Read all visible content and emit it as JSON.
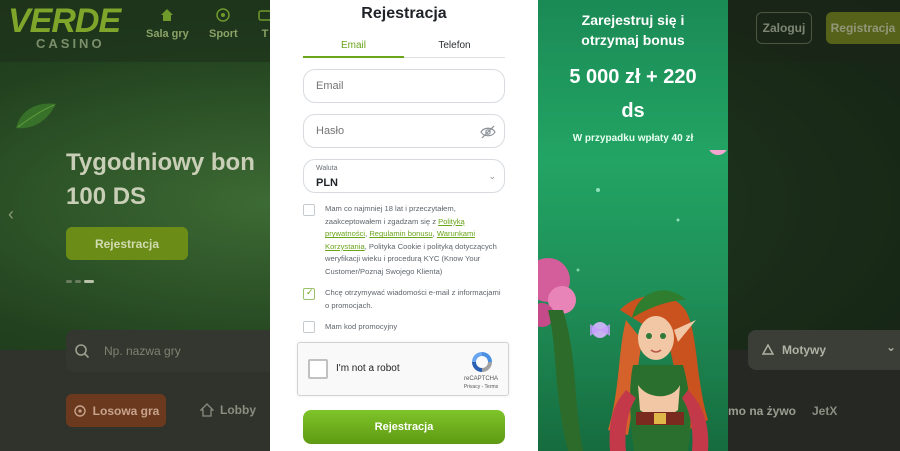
{
  "background": {
    "logo": {
      "main": "VERDE",
      "sub": "CASINO"
    },
    "nav": [
      {
        "label": "Sala gry",
        "icon": "home-icon"
      },
      {
        "label": "Sport",
        "icon": "soccer-ball-icon"
      },
      {
        "label": "T",
        "icon": "tv-icon"
      }
    ],
    "header": {
      "login": "Zaloguj",
      "register": "Registracja"
    },
    "hero": {
      "title_line1": "Tygodniowy bon",
      "title_line2": "100 DS",
      "button": "Rejestracja"
    },
    "search": {
      "placeholder": "Np. nazwa gry"
    },
    "categories": {
      "random": "Losowa gra",
      "lobby": "Lobby",
      "live": "mo na żywo",
      "jetx": "JetX"
    },
    "filter": {
      "label": "Motywy"
    }
  },
  "modal": {
    "title": "Rejestracja",
    "tabs": [
      {
        "label": "Email",
        "active": true
      },
      {
        "label": "Telefon",
        "active": false
      }
    ],
    "email": {
      "placeholder": "Email"
    },
    "password": {
      "placeholder": "Hasło"
    },
    "currency": {
      "label": "Waluta",
      "value": "PLN"
    },
    "terms": {
      "text_before": "Mam co najmniej 18 lat i przeczytałem, zaakceptowałem i zgadzam się z ",
      "link1": "Polityką prywatności",
      "sep1": ", ",
      "link2": "Regulamin bonusu",
      "sep2": ", ",
      "link3": "Warunkami Korzystania",
      "text_after": ", Polityka Cookie i polityką dotyczących weryfikacji wieku i procedurą KYC (Know Your Customer/Poznaj Swojego Klienta)",
      "checked": false
    },
    "newsletter": {
      "text": "Chcę otrzymywać wiadomości e-mail z informacjami o promocjach.",
      "checked": true
    },
    "promo_code": {
      "text": "Mam kod promocyjny",
      "checked": false
    },
    "captcha": {
      "label": "I'm not a robot",
      "brand": "reCAPTCHA",
      "links": "Privacy - Terms"
    },
    "submit": "Rejestracja"
  },
  "promo": {
    "headline_line1": "Zarejestruj się i",
    "headline_line2": "otrzymaj bonus",
    "amount_line1": "5 000 zł + 220",
    "amount_line2": "ds",
    "note": "W przypadku wpłaty 40 zł"
  },
  "colors": {
    "accent": "#6aa51a",
    "promo_bg": "#22a464",
    "button": "#7fc42a"
  }
}
